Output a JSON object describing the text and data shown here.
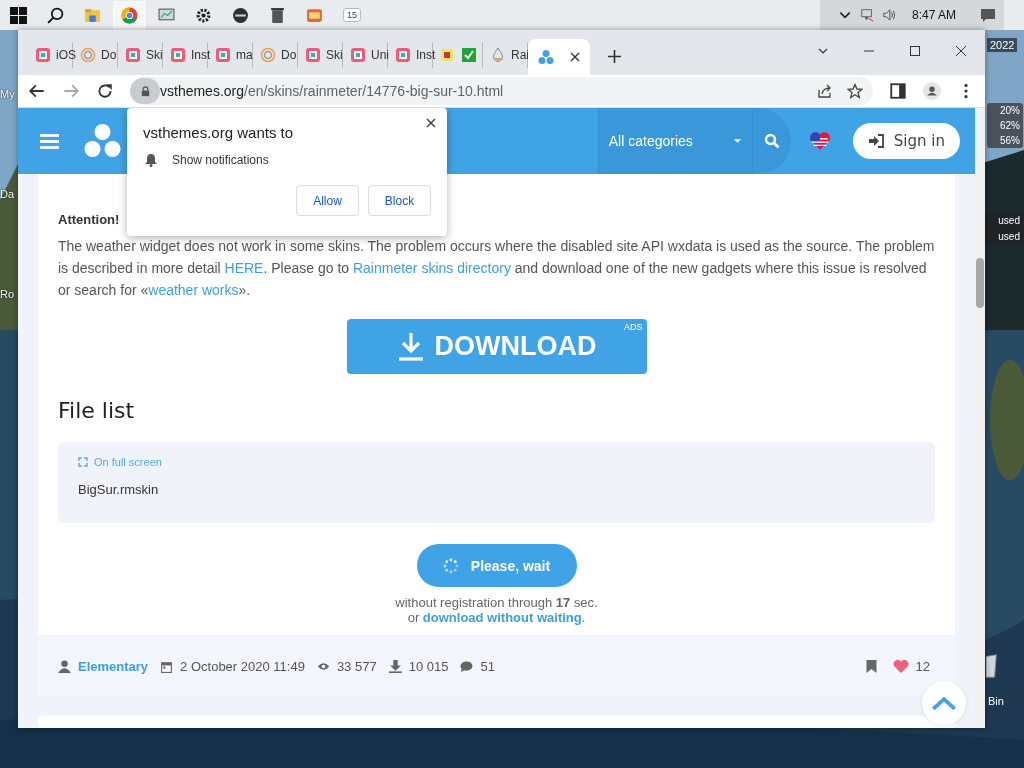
{
  "taskbar": {
    "calendar_badge": "15",
    "clock": "8:47 AM"
  },
  "desktop": {
    "left_labels": [
      "My",
      "Da",
      "Ro"
    ],
    "year_label": "2022",
    "gauge_readings": [
      "20%",
      "62%",
      "56%"
    ],
    "disk_labels": [
      "used",
      "used"
    ],
    "bin_label": "Bin"
  },
  "browser": {
    "tabs": [
      {
        "kind": "sp",
        "title": "iOS",
        "selected": false
      },
      {
        "kind": "spiral",
        "title": "Do",
        "selected": false
      },
      {
        "kind": "sp",
        "title": "Ski",
        "selected": false
      },
      {
        "kind": "sp",
        "title": "Inst",
        "selected": false
      },
      {
        "kind": "sp",
        "title": "ma",
        "selected": false
      },
      {
        "kind": "spiral",
        "title": "Do",
        "selected": false
      },
      {
        "kind": "sp",
        "title": "Ski",
        "selected": false
      },
      {
        "kind": "sp",
        "title": "Uni",
        "selected": false
      },
      {
        "kind": "sp",
        "title": "Inst",
        "selected": false
      },
      {
        "kind": "pair",
        "selected": false
      },
      {
        "kind": "drop",
        "title": "Rai",
        "selected": false
      },
      {
        "kind": "logo",
        "selected": true
      }
    ],
    "url": {
      "host": "vsthemes.org",
      "path": "/en/skins/rainmeter/14776-big-sur-10.html"
    }
  },
  "site_header": {
    "category": "All categories",
    "sign_in": "Sign in"
  },
  "permission_popup": {
    "title": "vsthemes.org wants to",
    "request": "Show notifications",
    "buttons": [
      "Allow",
      "Block"
    ]
  },
  "article": {
    "attention": "Attention!",
    "paragraph": [
      {
        "kind": "text",
        "text": "The weather widget does not work in some skins. The problem occurs where the disabled site API wxdata is used as the source. The problem is described in more detail "
      },
      {
        "kind": "link",
        "text": "HERE"
      },
      {
        "kind": "text",
        "text": ". Please go to "
      },
      {
        "kind": "link",
        "text": "Rainmeter skins directory"
      },
      {
        "kind": "text",
        "text": " and download one of the new gadgets where this issue is resolved or search for «"
      },
      {
        "kind": "link",
        "text": "weather works"
      },
      {
        "kind": "text",
        "text": "»."
      }
    ],
    "download_button": "DOWNLOAD",
    "ads_badge": "ADS",
    "file_list": {
      "heading": "File list",
      "fullscreen": "On full screen",
      "files": [
        "BigSur.rmskin"
      ]
    },
    "wait_button": "Please, wait",
    "wait_note": "without registration through **17** sec.",
    "skip_prefix": "or",
    "skip_link": "download without waiting",
    "skip_suffix": "."
  },
  "meta": {
    "author": "Elementary",
    "date": "2 October 2020 11:49",
    "views": "33 577",
    "downloads": "10 015",
    "comments": "51",
    "likes": "12"
  }
}
